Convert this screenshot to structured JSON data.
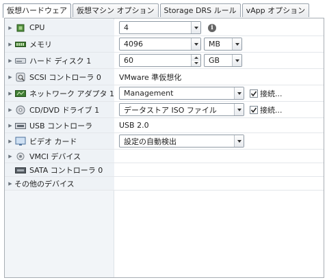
{
  "tabs": [
    {
      "label": "仮想ハードウェア",
      "active": true
    },
    {
      "label": "仮想マシン オプション",
      "active": false
    },
    {
      "label": "Storage DRS ルール",
      "active": false
    },
    {
      "label": "vApp オプション",
      "active": false
    }
  ],
  "rows": {
    "cpu": {
      "label": "CPU",
      "value": "4"
    },
    "memory": {
      "label": "メモリ",
      "value": "4096",
      "unit": "MB"
    },
    "disk": {
      "label": "ハード ディスク 1",
      "value": "60",
      "unit": "GB"
    },
    "scsi": {
      "label": "SCSI コントローラ 0",
      "value": "VMware 準仮想化"
    },
    "network": {
      "label": "ネットワーク アダプタ 1",
      "value": "Management",
      "check_label": "接続..."
    },
    "cddvd": {
      "label": "CD/DVD ドライブ 1",
      "value": "データストア ISO ファイル",
      "check_label": "接続..."
    },
    "usb": {
      "label": "USB コントローラ",
      "value": "USB 2.0"
    },
    "video": {
      "label": "ビデオ カード",
      "value": "設定の自動検出"
    },
    "vmci": {
      "label": "VMCI デバイス"
    },
    "sata": {
      "label": "SATA コントローラ 0"
    },
    "other": {
      "label": "その他のデバイス"
    }
  },
  "colors": {
    "accent": "#1b6bc6",
    "panel_border": "#a7adb3",
    "left_bg": "#eef2f6"
  }
}
